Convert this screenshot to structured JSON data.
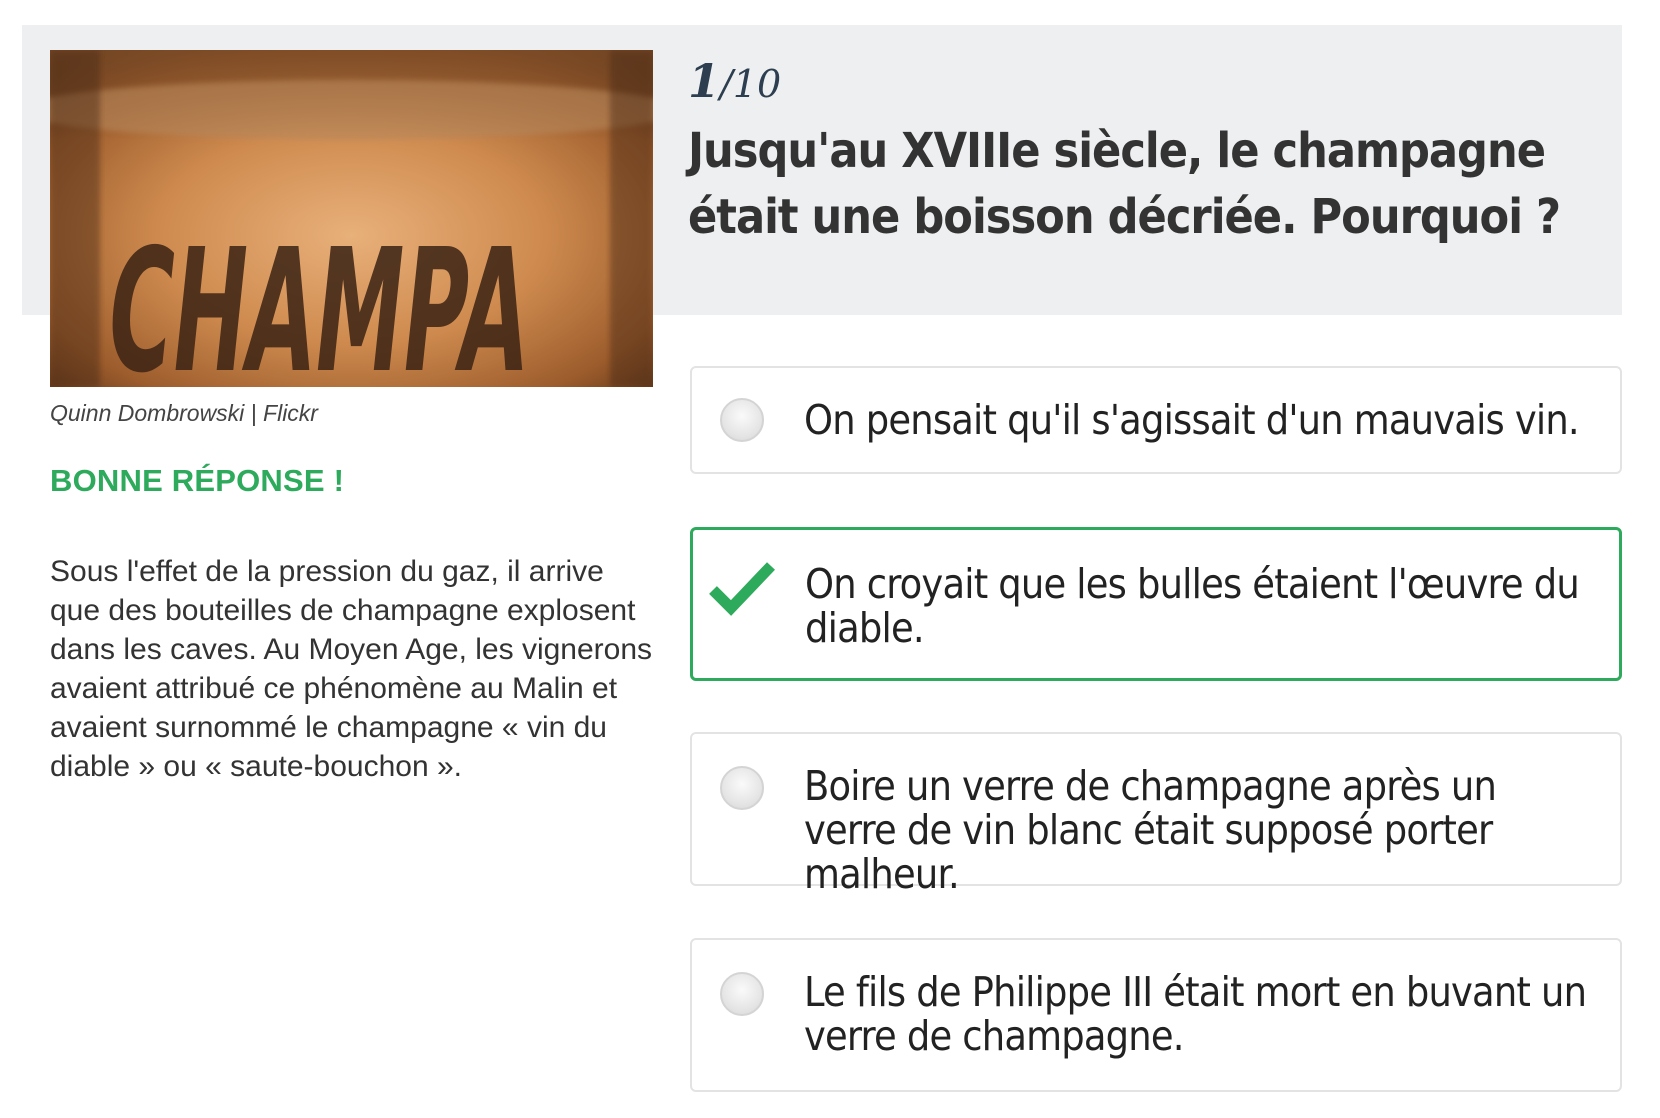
{
  "photo": {
    "word": "CHAMPA",
    "credit": "Quinn Dombrowski | Flickr"
  },
  "result": {
    "label": "BONNE RÉPONSE !",
    "explanation": "Sous l'effet de la pression du gaz, il arrive que des bouteilles de champagne explosent dans les caves. Au Moyen Age, les vignerons avaient attribué ce phénomène au Malin et avaient surnommé le champagne « vin du diable » ou « saute-bouchon »."
  },
  "quiz": {
    "current": "1",
    "total": "/10",
    "question": "Jusqu'au XVIIIe siècle, le champagne était une boisson décriée. Pourquoi ?",
    "answers": [
      {
        "text": "On pensait qu'il s'agissait d'un mauvais vin.",
        "state": "unselected"
      },
      {
        "text": "On croyait que les bulles étaient l'œuvre du diable.",
        "state": "correct"
      },
      {
        "text": "Boire un verre de champagne après un verre de vin blanc était supposé porter malheur.",
        "state": "unselected"
      },
      {
        "text": "Le fils de Philippe III était mort en buvant un verre de champagne.",
        "state": "unselected"
      }
    ]
  },
  "colors": {
    "correct": "#2eaa5c",
    "header_band": "#edeff0",
    "counter": "#2c3e50"
  },
  "icons": {
    "correct_answer": "checkmark-icon",
    "unselected_answer": "radio-circle-icon"
  }
}
